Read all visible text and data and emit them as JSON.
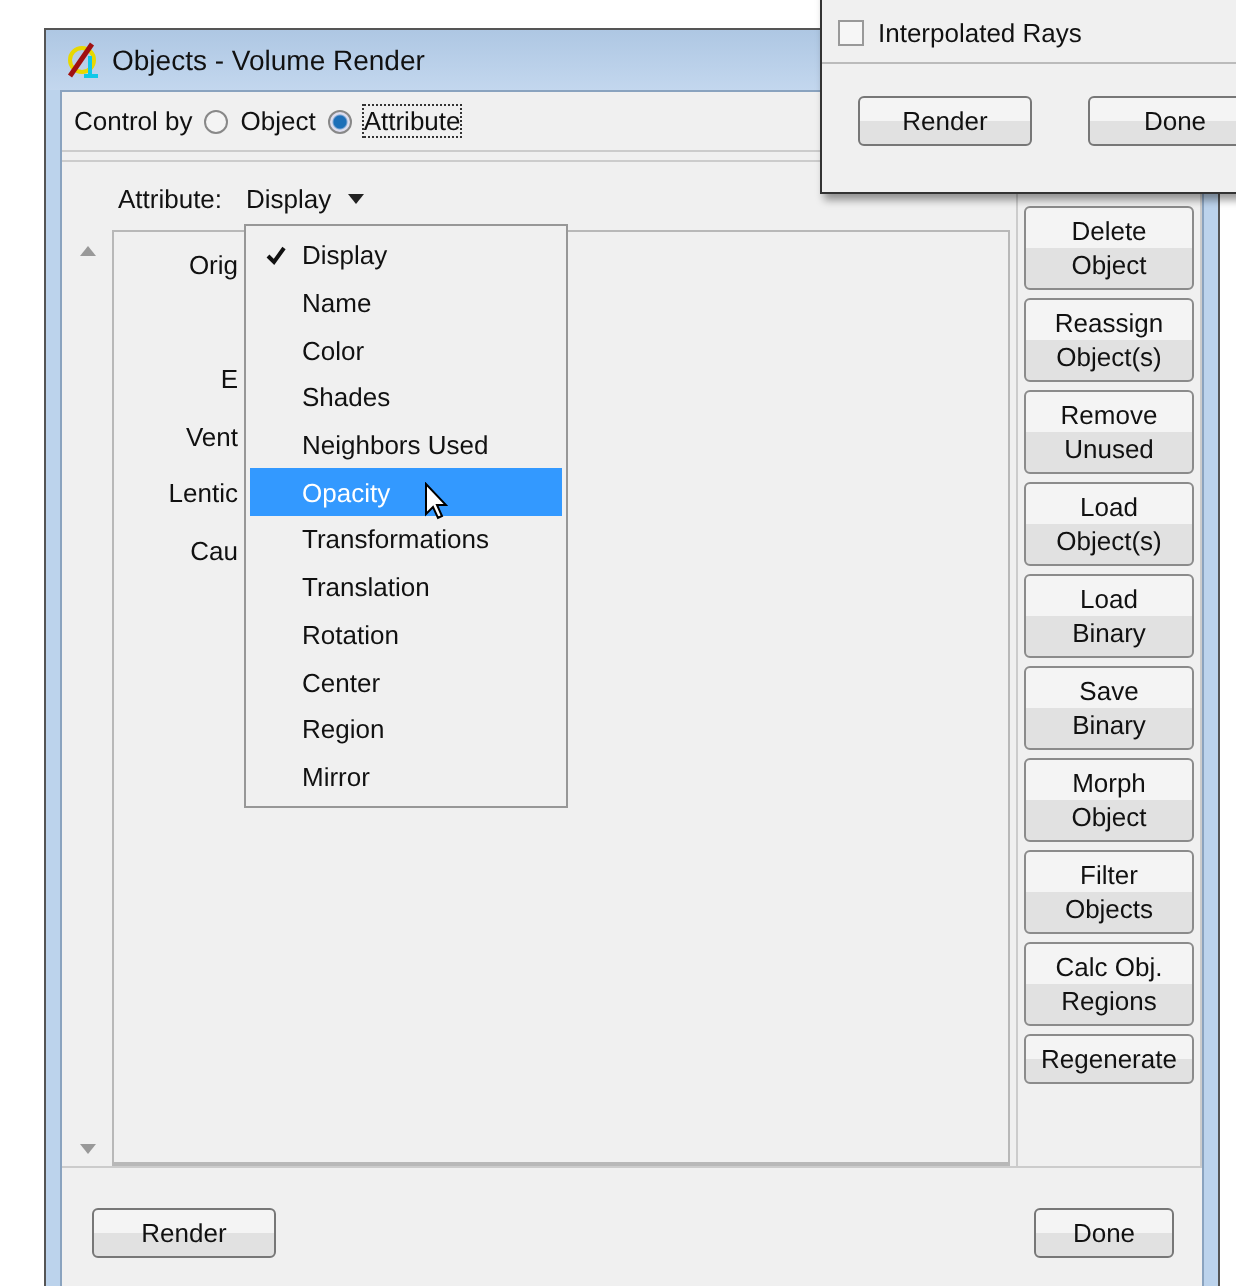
{
  "window": {
    "title": "Objects - Volume Render"
  },
  "control_by": {
    "label": "Control by",
    "options": [
      {
        "label": "Object",
        "selected": false
      },
      {
        "label": "Attribute",
        "selected": true
      }
    ]
  },
  "attribute": {
    "label": "Attribute:",
    "value": "Display"
  },
  "list_labels": [
    "Orig",
    "E",
    "Vent",
    "Lentic",
    "Cau"
  ],
  "attribute_menu": [
    {
      "label": "Display",
      "checked": true,
      "selected": false
    },
    {
      "label": "Name",
      "checked": false,
      "selected": false
    },
    {
      "label": "Color",
      "checked": false,
      "selected": false
    },
    {
      "label": "Shades",
      "checked": false,
      "selected": false
    },
    {
      "label": "Neighbors Used",
      "checked": false,
      "selected": false
    },
    {
      "label": "Opacity",
      "checked": false,
      "selected": true
    },
    {
      "label": "Transformations",
      "checked": false,
      "selected": false
    },
    {
      "label": "Translation",
      "checked": false,
      "selected": false
    },
    {
      "label": "Rotation",
      "checked": false,
      "selected": false
    },
    {
      "label": "Center",
      "checked": false,
      "selected": false
    },
    {
      "label": "Region",
      "checked": false,
      "selected": false
    },
    {
      "label": "Mirror",
      "checked": false,
      "selected": false
    }
  ],
  "side_buttons": [
    "Delete\nObject",
    "Reassign\nObject(s)",
    "Remove\nUnused",
    "Load\nObject(s)",
    "Load\nBinary",
    "Save\nBinary",
    "Morph\nObject",
    "Filter\nObjects",
    "Calc Obj.\nRegions",
    "Regenerate"
  ],
  "buttons": [
    "Render",
    "Done"
  ],
  "back_window": {
    "checkbox": {
      "label": "Interpolated Rays",
      "checked": false
    },
    "buttons": [
      "Render",
      "Done"
    ]
  }
}
